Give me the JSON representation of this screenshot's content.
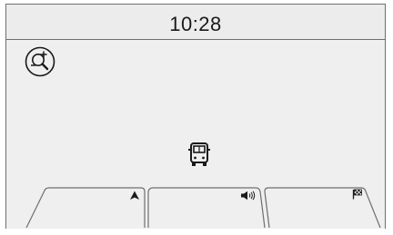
{
  "status_bar": {
    "time": "10:28"
  },
  "map": {
    "zoom_icon": "magnifier-plus-minus-icon",
    "vehicle_icon": "vehicle-front-icon"
  },
  "bottom_tabs": [
    {
      "id": "navigation",
      "icon": "navigation-arrow-icon"
    },
    {
      "id": "volume",
      "icon": "speaker-volume-icon"
    },
    {
      "id": "destination",
      "icon": "checkered-flag-icon"
    }
  ],
  "colors": {
    "frame": "#6f6f6f",
    "background": "#eeeeee",
    "icon": "#1a1a1a"
  }
}
